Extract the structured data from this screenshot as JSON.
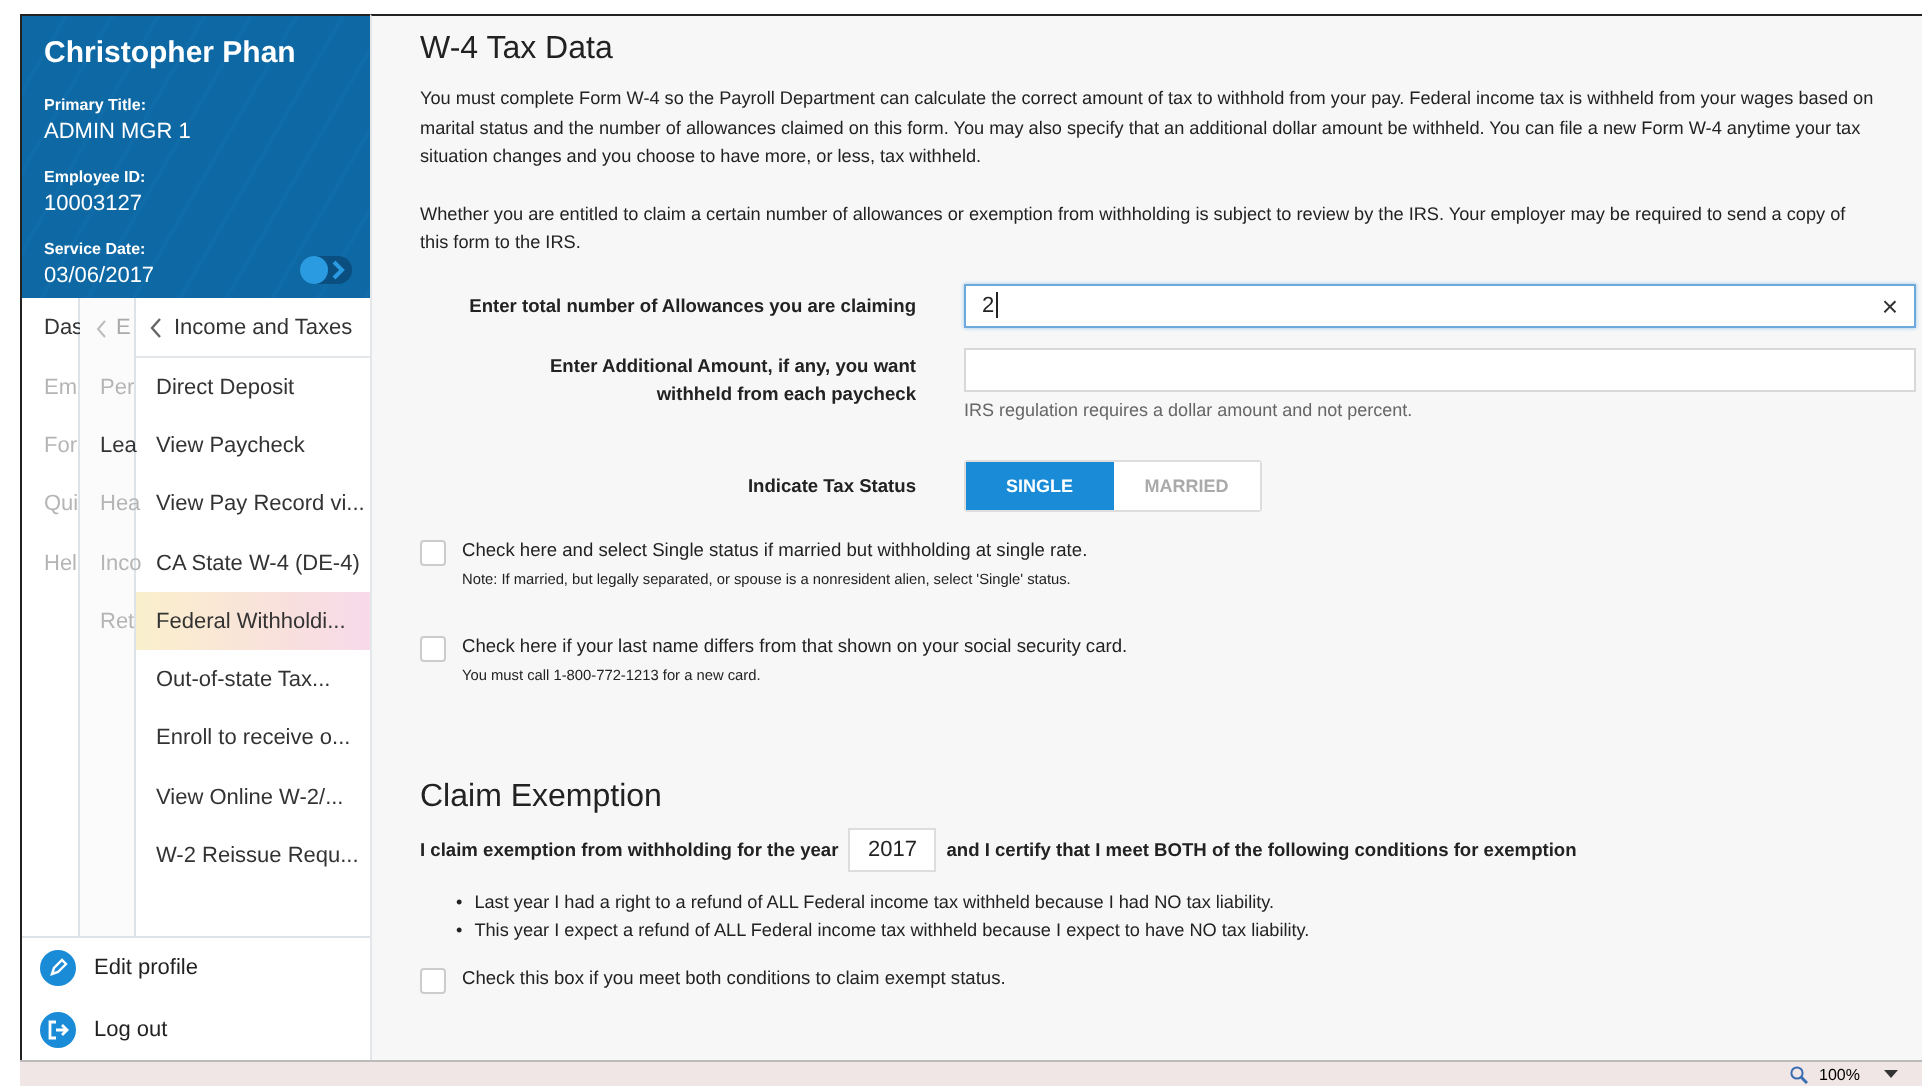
{
  "profile": {
    "name": "Christopher Phan",
    "fields": [
      {
        "label": "Primary Title:",
        "value": "ADMIN MGR 1"
      },
      {
        "label": "Employee ID:",
        "value": "10003127"
      },
      {
        "label": "Service Date:",
        "value": "03/06/2017"
      }
    ]
  },
  "nav": {
    "column_1": [
      {
        "label": "Das",
        "dimmed": false
      },
      {
        "label": "Em",
        "dimmed": true
      },
      {
        "label": "For",
        "dimmed": true
      },
      {
        "label": "Qui",
        "dimmed": true
      },
      {
        "label": "Hel",
        "dimmed": true
      }
    ],
    "column_2": {
      "header": "E",
      "items": [
        {
          "label": "Per",
          "dimmed": true
        },
        {
          "label": "Lea",
          "dimmed": false
        },
        {
          "label": "Hea",
          "dimmed": true
        },
        {
          "label": "Inco",
          "dimmed": true
        },
        {
          "label": "Ret",
          "dimmed": true
        }
      ]
    },
    "column_3": {
      "header": "Income and Taxes",
      "items": [
        {
          "label": "Direct Deposit",
          "selected": false
        },
        {
          "label": "View Paycheck",
          "selected": false
        },
        {
          "label": "View Pay Record vi...",
          "selected": false
        },
        {
          "label": "CA State W-4 (DE-4)",
          "selected": false
        },
        {
          "label": "Federal Withholdi...",
          "selected": true
        },
        {
          "label": "Out-of-state Tax...",
          "selected": false
        },
        {
          "label": "Enroll to receive o...",
          "selected": false
        },
        {
          "label": "View Online W-2/...",
          "selected": false
        },
        {
          "label": "W-2 Reissue Requ...",
          "selected": false
        }
      ]
    }
  },
  "actions": [
    {
      "kind": "edit",
      "label": "Edit profile"
    },
    {
      "kind": "logout",
      "label": "Log out"
    }
  ],
  "main": {
    "title": "W-4 Tax Data",
    "paragraphs": [
      "You must complete Form W-4 so the Payroll Department can calculate the correct amount of tax to withhold from your pay.  Federal income tax is withheld from your wages based on marital status and the number of allowances claimed on this form.  You may also specify that an additional dollar amount be withheld.  You can file a new Form W-4 anytime your tax situation changes and you choose to have more, or less, tax withheld.",
      "Whether you are entitled to claim a certain number of allowances or exemption from withholding is subject to review by the IRS.  Your employer may be required to send a copy of this form to the IRS."
    ],
    "allowances": {
      "label": "Enter total number of Allowances you are claiming",
      "value": "2",
      "clear": "×"
    },
    "additional": {
      "label": "Enter Additional Amount, if any, you want withheld from each paycheck",
      "hint": "IRS regulation requires a dollar amount and not percent."
    },
    "tax_status": {
      "label": "Indicate Tax Status",
      "options": [
        {
          "label": "SINGLE",
          "selected": true
        },
        {
          "label": "MARRIED",
          "selected": false
        }
      ]
    },
    "checks": [
      {
        "label": "Check here and select Single status if married but withholding at single rate.",
        "note": "Note: If married, but legally separated, or spouse is a nonresident alien, select 'Single' status.",
        "checked": false
      },
      {
        "label": "Check here if your last name differs from that shown on your social security card.",
        "note": "You must call 1-800-772-1213 for a new card.",
        "checked": false
      }
    ]
  },
  "exemption": {
    "title": "Claim Exemption",
    "before": "I claim exemption from withholding for the year",
    "year": "2017",
    "after": "and I certify that I meet BOTH of the following conditions for exemption",
    "bullet_marker": "•",
    "bullets": [
      "Last year I had a right to a refund of ALL Federal income tax withheld because I had NO tax liability.",
      "This year I expect a refund of ALL Federal income tax withheld because I expect to have NO tax liability."
    ],
    "check": {
      "label": "Check this box if you meet both conditions to claim exempt status.",
      "checked": false
    }
  },
  "status_bar": {
    "zoom": "100%"
  }
}
